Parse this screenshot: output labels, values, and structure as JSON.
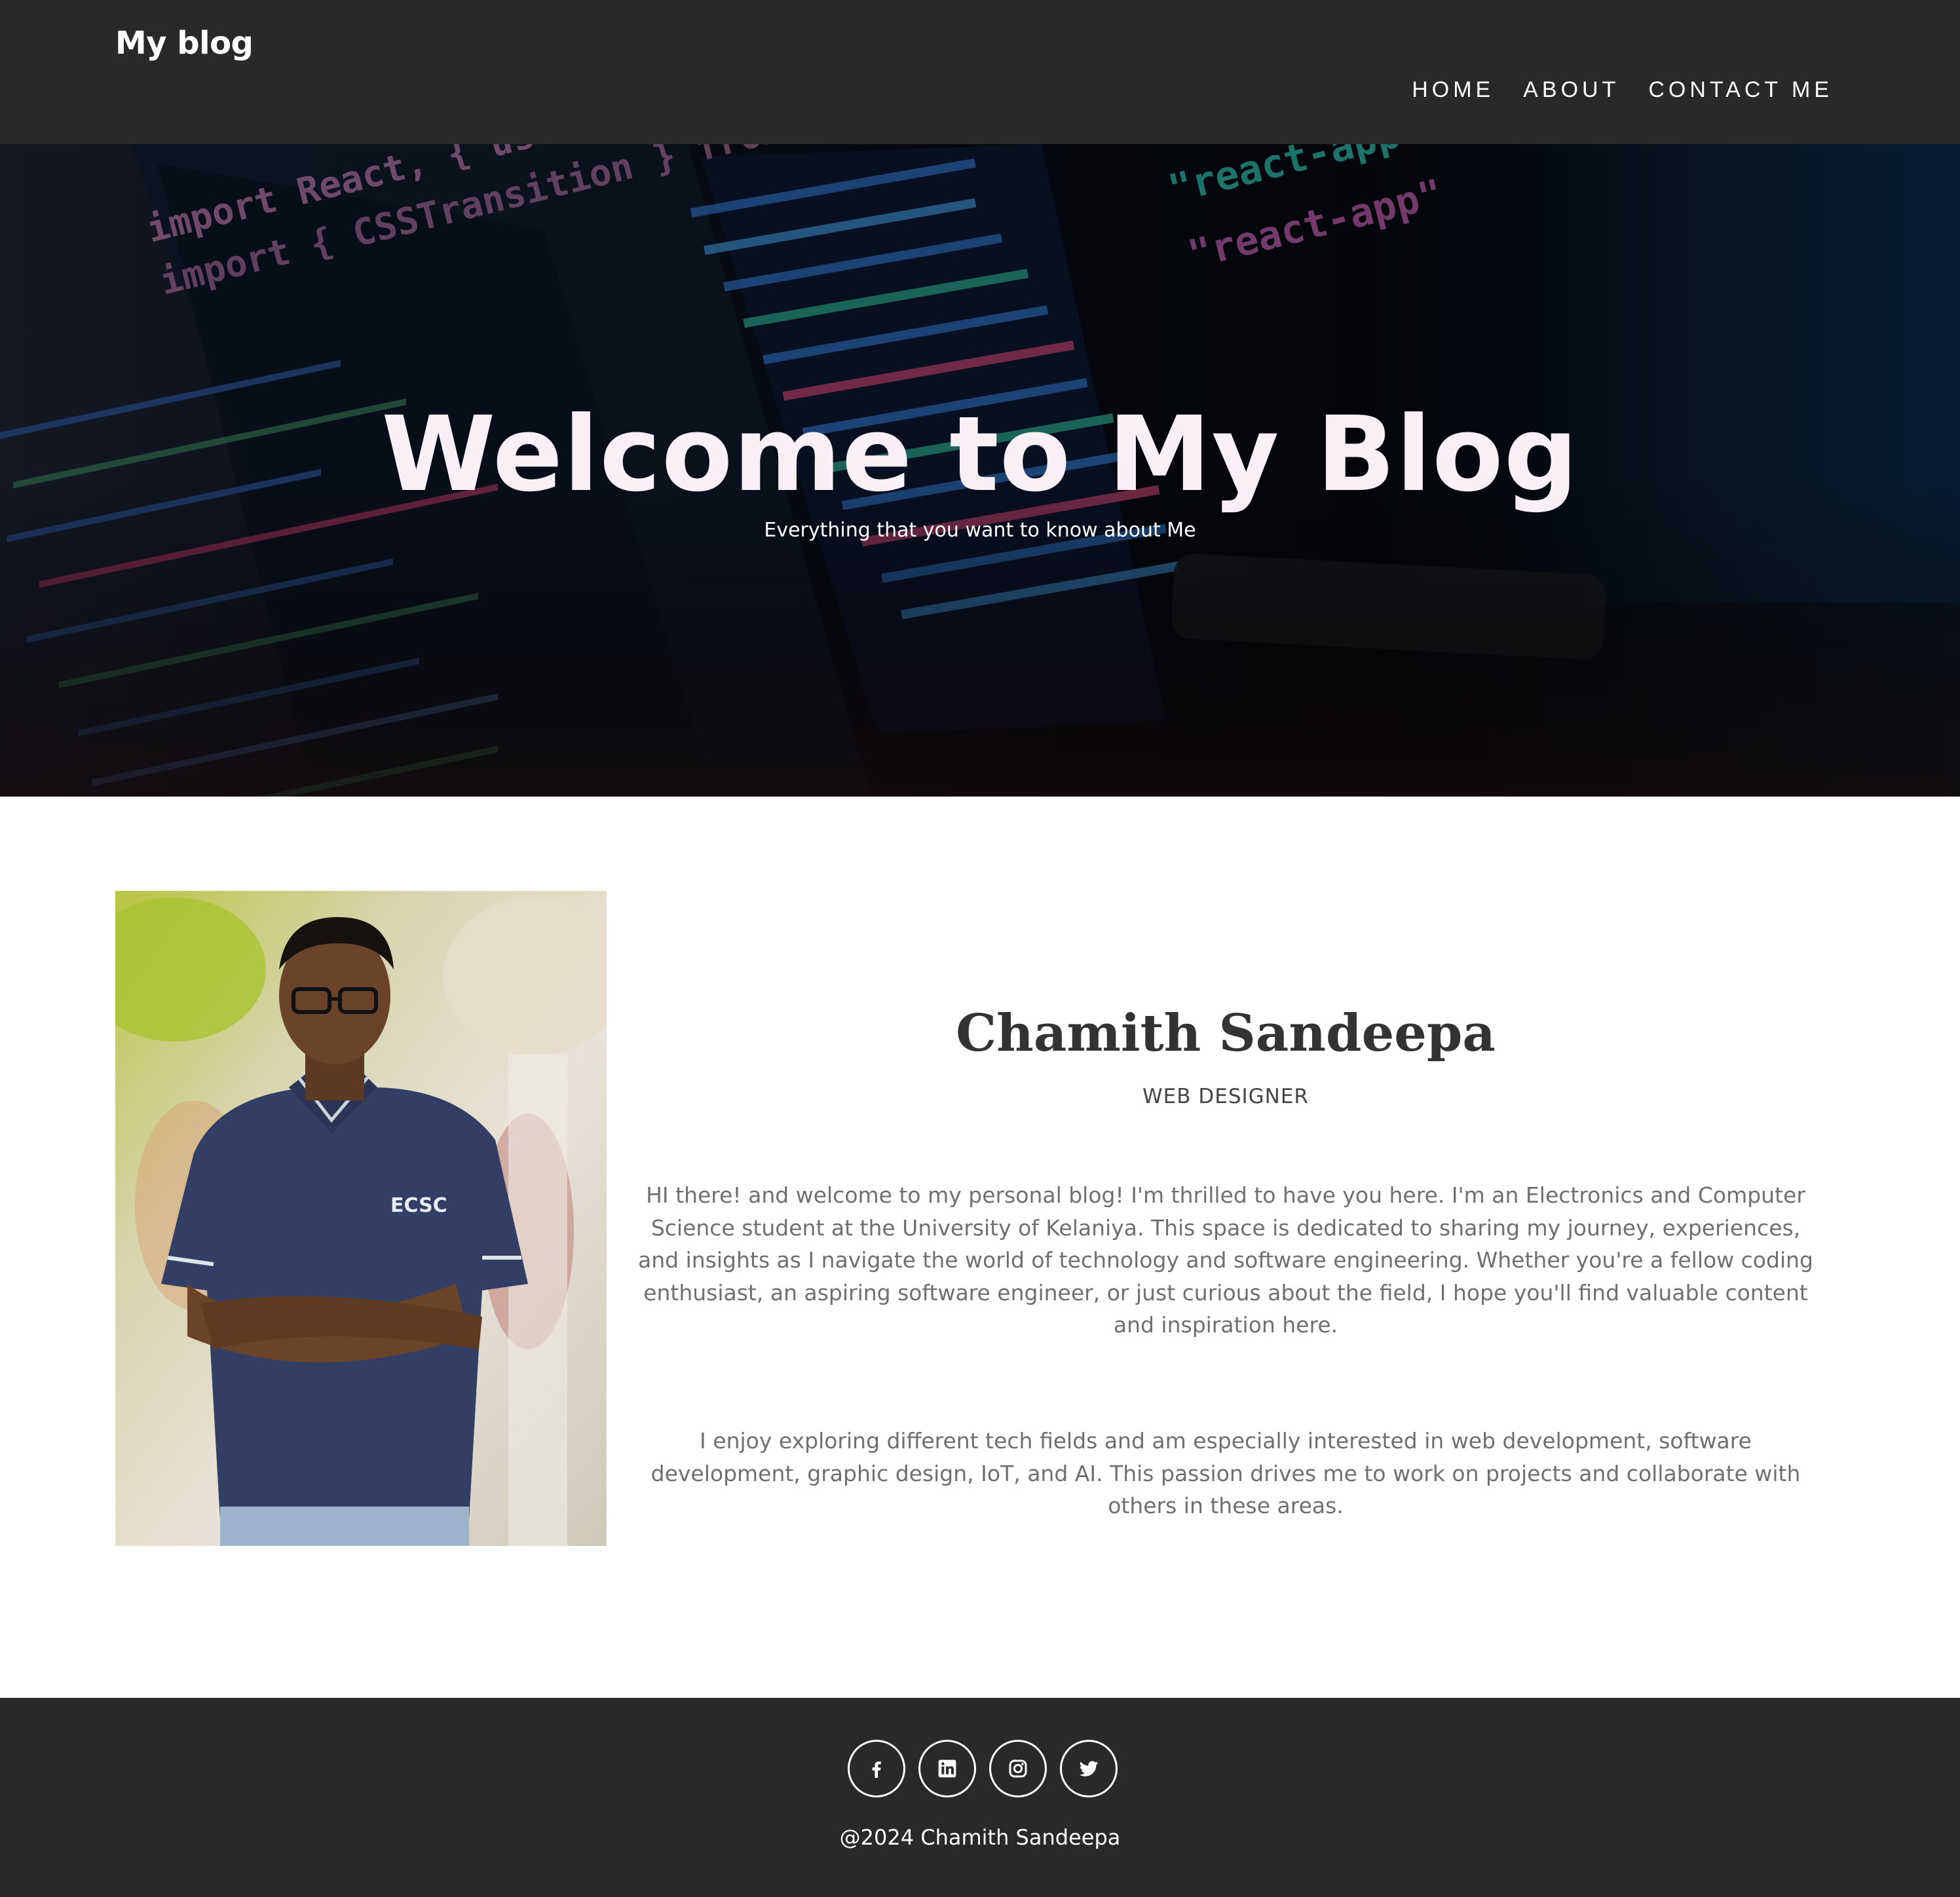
{
  "navbar": {
    "brand": "My blog",
    "links": [
      "HOME",
      "ABOUT",
      "CONTACT ME"
    ]
  },
  "hero": {
    "title": "Welcome to My Blog",
    "subtitle": "Everything that you want to know about Me",
    "code_overlay": [
      "import React, { useState, useE",
      "import { CSSTransition } from \"react-transitio",
      "\"react-app\"",
      "\"react-app\""
    ]
  },
  "about": {
    "name": "Chamith Sandeepa",
    "role": "WEB DESIGNER",
    "paragraphs": [
      "HI there! and welcome to my personal blog! I'm thrilled to have you here. I'm an Electronics and Computer Science student at the University of Kelaniya. This space is dedicated to sharing my journey, experiences, and insights as I navigate the world of technology and software engineering. Whether you're a fellow coding enthusiast, an aspiring software engineer, or just curious about the field, I hope you'll find valuable content and inspiration here.",
      "I enjoy exploring different tech fields and am especially interested in web development, software development, graphic design, IoT, and AI. This passion drives me to work on projects and collaborate with others in these areas."
    ],
    "shirt_logo": "ECSC"
  },
  "footer": {
    "social": [
      {
        "icon": "facebook-icon"
      },
      {
        "icon": "linkedin-icon"
      },
      {
        "icon": "instagram-icon"
      },
      {
        "icon": "twitter-icon"
      }
    ],
    "copyright": "@2024 Chamith Sandeepa"
  },
  "colors": {
    "nav_bg": "#292929",
    "footer_bg": "#292929",
    "heading": "#333333",
    "body_text": "#6f6f6f"
  }
}
